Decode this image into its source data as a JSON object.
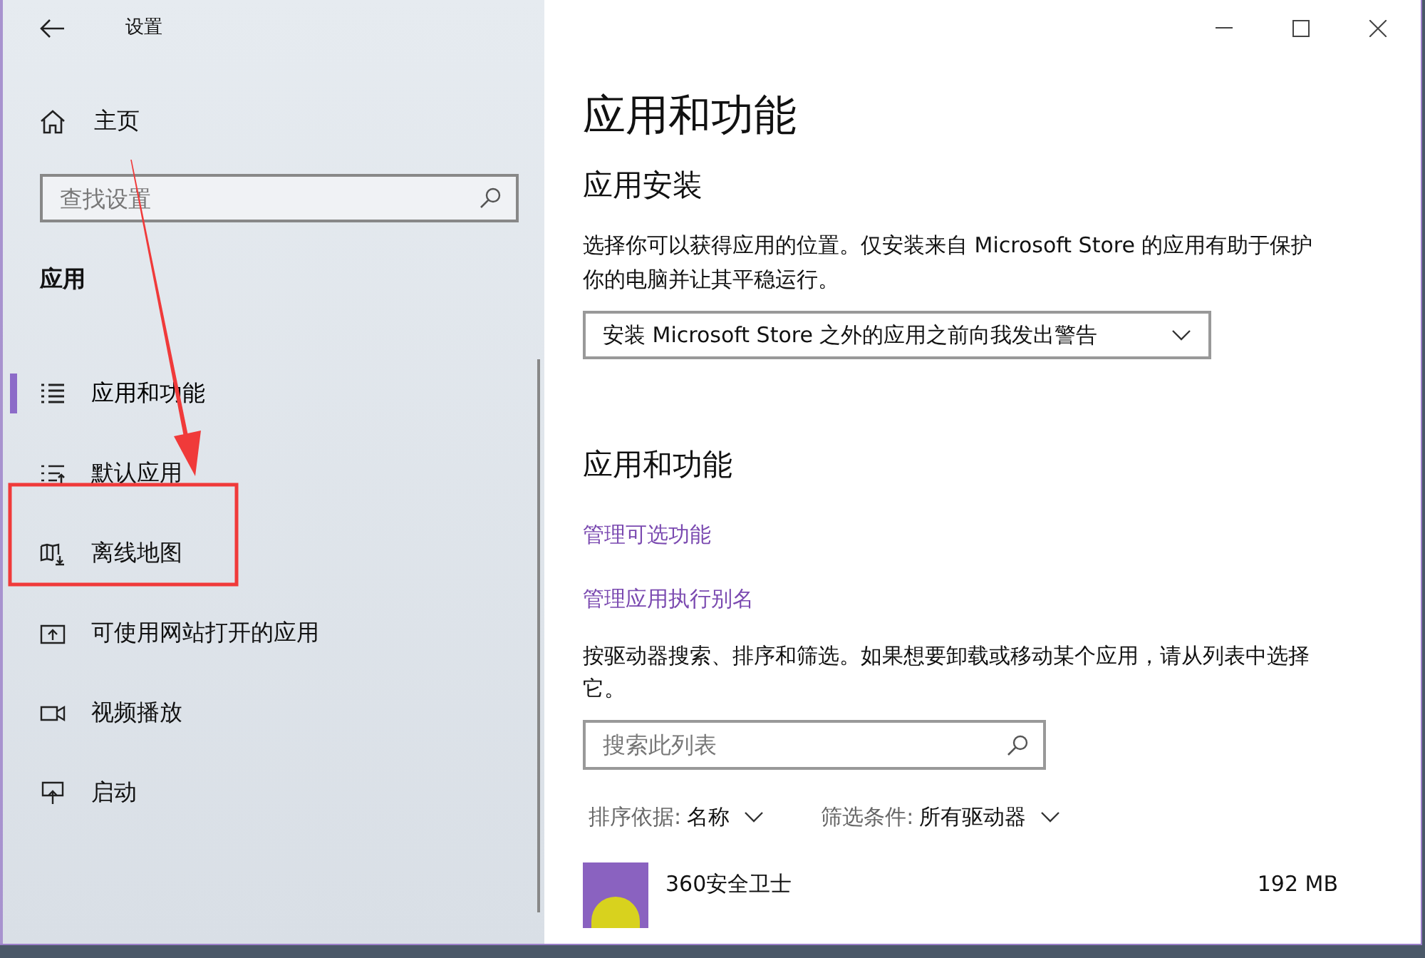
{
  "window": {
    "title": "设置"
  },
  "sidebar": {
    "home": "主页",
    "search": {
      "placeholder": "查找设置"
    },
    "section": "应用",
    "items": [
      {
        "label": "应用和功能",
        "kind": "list",
        "selected": true
      },
      {
        "label": "默认应用",
        "kind": "default",
        "selected": false
      },
      {
        "label": "离线地图",
        "kind": "map",
        "selected": false
      },
      {
        "label": "可使用网站打开的应用",
        "kind": "web",
        "selected": false
      },
      {
        "label": "视频播放",
        "kind": "video",
        "selected": false
      },
      {
        "label": "启动",
        "kind": "startup",
        "selected": false
      }
    ]
  },
  "content": {
    "title": "应用和功能",
    "install": {
      "heading": "应用安装",
      "description": "选择你可以获得应用的位置。仅安装来自 Microsoft Store 的应用有助于保护你的电脑并让其平稳运行。",
      "dropdown": "安装 Microsoft Store 之外的应用之前向我发出警告"
    },
    "apps": {
      "heading": "应用和功能",
      "links": [
        "管理可选功能",
        "管理应用执行别名"
      ],
      "description": "按驱动器搜索、排序和筛选。如果想要卸载或移动某个应用，请从列表中选择它。",
      "search": {
        "placeholder": "搜索此列表"
      },
      "sort": {
        "label": "排序依据:",
        "value": "名称"
      },
      "filter": {
        "label": "筛选条件:",
        "value": "所有驱动器"
      },
      "list": [
        {
          "name": "360安全卫士",
          "size": "192 MB"
        }
      ]
    }
  },
  "annotations": {
    "arrow": true,
    "highlight_box": true
  }
}
